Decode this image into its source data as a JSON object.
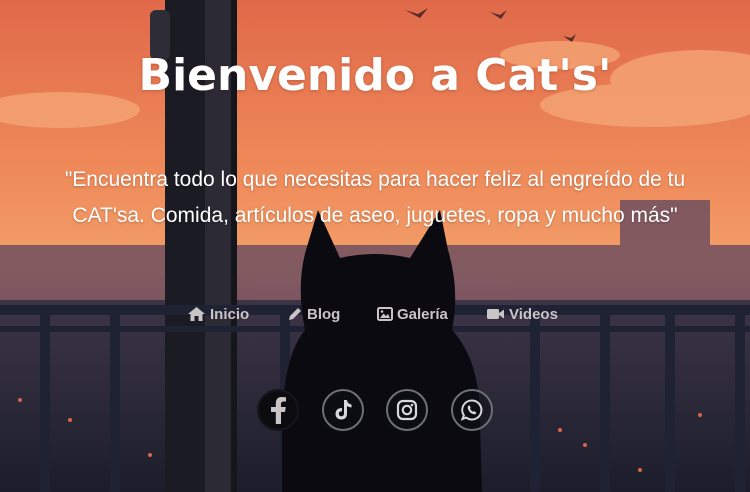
{
  "hero": {
    "title": "Bienvenido a Cat's'",
    "tagline_line1": "\"Encuentra todo lo que necesitas para hacer feliz al engreído de tu",
    "tagline_line2": "CAT'sa. Comida, artículos de aseo, juguetes, ropa y mucho más\""
  },
  "nav": {
    "items": [
      {
        "label": "Inicio",
        "icon": "home-icon"
      },
      {
        "label": "Blog",
        "icon": "pencil-icon"
      },
      {
        "label": "Galería",
        "icon": "image-icon"
      },
      {
        "label": "Videos",
        "icon": "video-camera-icon"
      }
    ]
  },
  "social": [
    {
      "name": "Facebook",
      "icon": "facebook-icon"
    },
    {
      "name": "TikTok",
      "icon": "tiktok-icon"
    },
    {
      "name": "Instagram",
      "icon": "instagram-icon"
    },
    {
      "name": "WhatsApp",
      "icon": "whatsapp-icon"
    }
  ],
  "colors": {
    "sky_top": "#e5734c",
    "sky_mid": "#f29a64",
    "horizon": "#7a5a6c",
    "railing": "#1c2030",
    "cat": "#0a0a10",
    "nav_text": "#c9c4c6",
    "heading_text": "#ffffff"
  }
}
